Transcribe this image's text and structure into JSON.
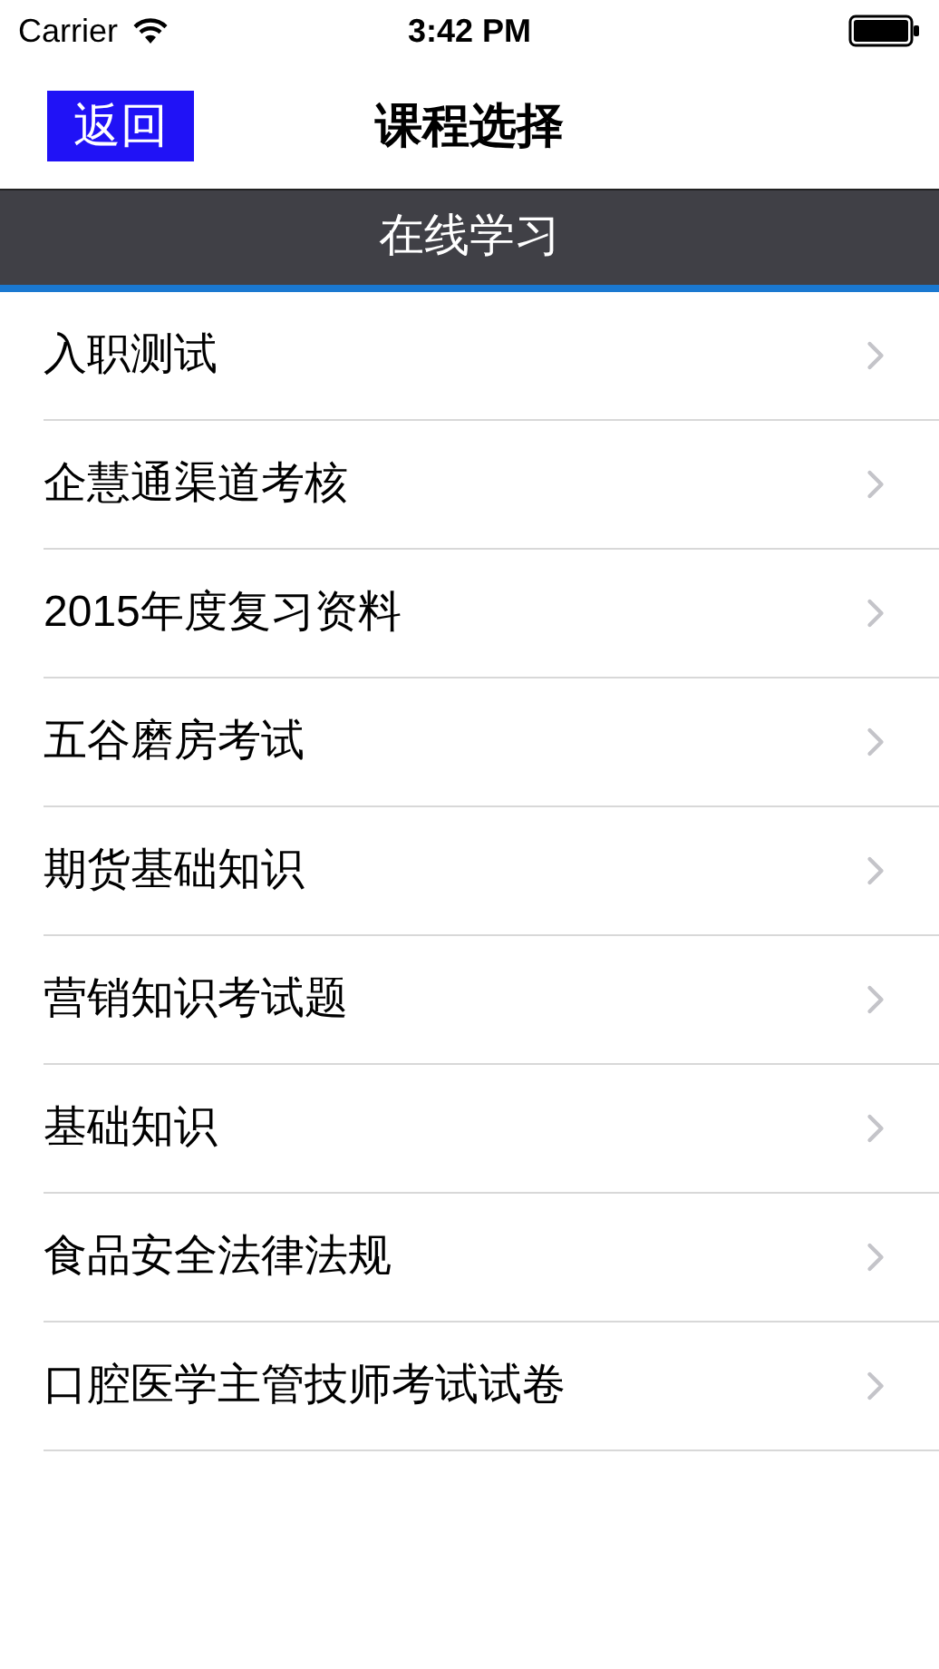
{
  "status_bar": {
    "carrier": "Carrier",
    "time": "3:42 PM"
  },
  "nav": {
    "back": "返回",
    "title": "课程选择"
  },
  "section": {
    "title": "在线学习"
  },
  "items": [
    {
      "label": "入职测试"
    },
    {
      "label": "企慧通渠道考核"
    },
    {
      "label": "2015年度复习资料"
    },
    {
      "label": "五谷磨房考试"
    },
    {
      "label": "期货基础知识"
    },
    {
      "label": "营销知识考试题"
    },
    {
      "label": "基础知识"
    },
    {
      "label": "食品安全法律法规"
    },
    {
      "label": "口腔医学主管技师考试试卷"
    }
  ]
}
